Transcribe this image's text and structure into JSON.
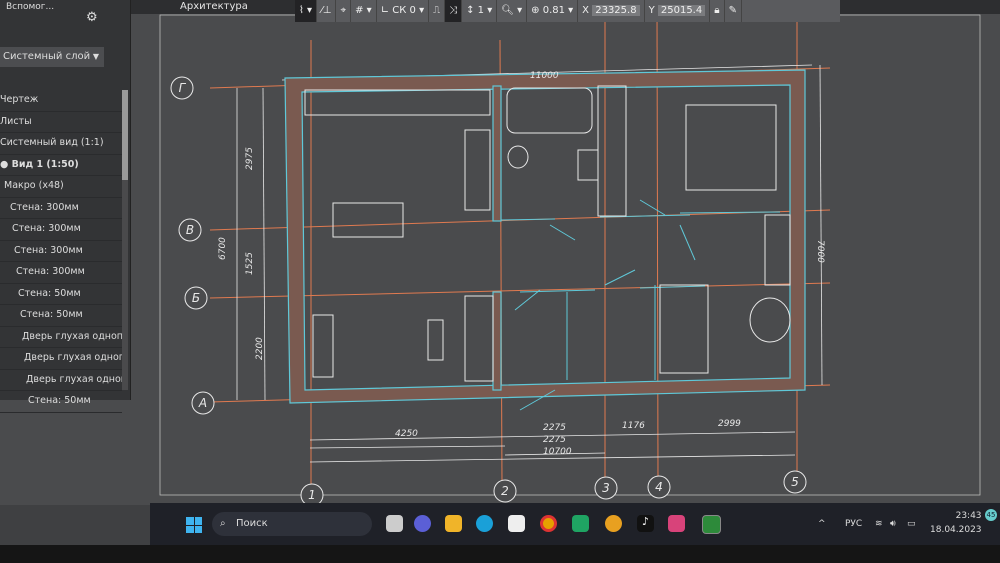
{
  "app": {
    "title": "Архитектура"
  },
  "left_panel": {
    "header": "Вспомог...",
    "layer_select": "Системный слой",
    "tree": [
      "Чертеж",
      "Листы",
      "Системный вид (1:1)",
      "● Вид 1 (1:50)",
      "Макро (x48)",
      "Стена: 300мм",
      "Стена: 300мм",
      "Стена: 300мм",
      "Стена: 300мм",
      "Стена: 50мм",
      "Стена: 50мм",
      "Дверь глухая одноп",
      "Дверь глухая одноп",
      "Дверь глухая одноп",
      "Стена: 50мм"
    ]
  },
  "toolbar": {
    "cs": "СК 0",
    "step": "1",
    "zoom": "0.81",
    "x_label": "X",
    "x_value": "23325.8",
    "y_label": "Y",
    "y_value": "25015.4"
  },
  "drawing": {
    "dims": {
      "overall_top": "11000",
      "left_total": "6700",
      "left_a": "2975",
      "left_b": "1525",
      "left_c": "2200",
      "right": "7000",
      "bottom_1": "4250",
      "bottom_2": "2275",
      "bottom_3": "1176",
      "bottom_4": "2999",
      "bottom_5": "2275",
      "bottom_total": "10700"
    },
    "axes_rows": [
      "Г",
      "В",
      "Б",
      "А"
    ],
    "axes_cols": [
      "1",
      "2",
      "3",
      "4",
      "5"
    ]
  },
  "taskbar": {
    "search_placeholder": "Поиск",
    "language": "РУС",
    "time": "23:43",
    "date": "18.04.2023",
    "notifications": "45"
  },
  "colors": {
    "wall": "#5fc8d8",
    "axis": "#e07a50",
    "line": "#e8e8e8",
    "canvas": "#4a4b4d"
  }
}
